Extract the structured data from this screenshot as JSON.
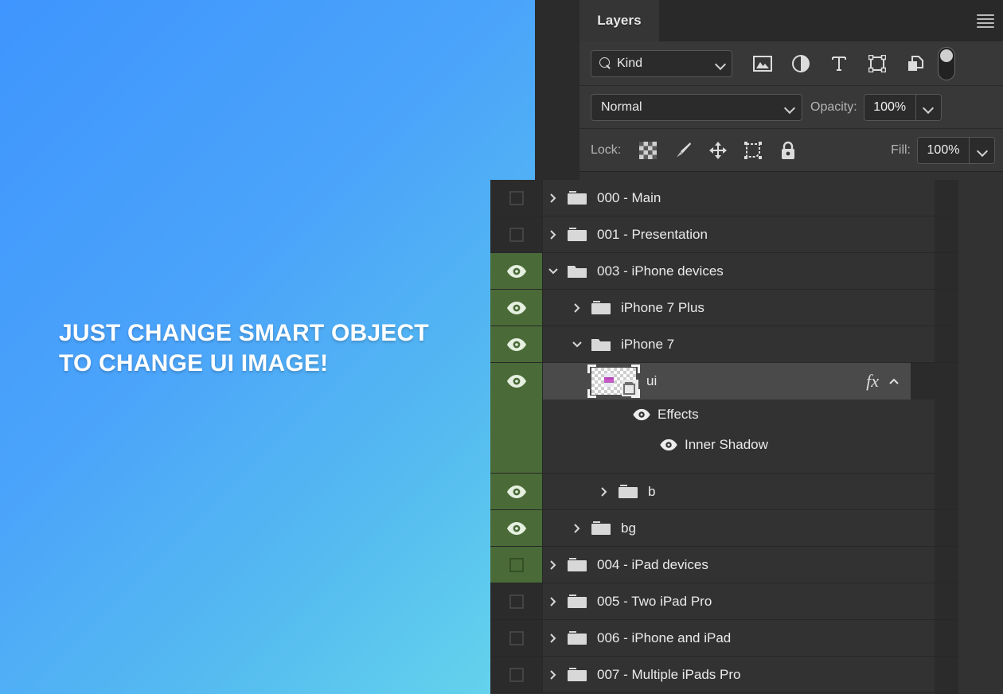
{
  "artwork": {
    "headline_line1": "JUST CHANGE SMART OBJECT",
    "headline_line2": "TO CHANGE UI IMAGE!",
    "gradient_start": "#3f95fd",
    "gradient_end": "#66d6ec"
  },
  "panel": {
    "tab_label": "Layers",
    "menu_icon": "hamburger-menu-icon",
    "filter": {
      "kind_label": "Kind",
      "search_icon": "search-icon",
      "dropdown_icon": "chevron-down-icon",
      "icons": [
        {
          "name": "pixel-layer-filter-icon",
          "title": "Pixels"
        },
        {
          "name": "adjustment-layer-filter-icon",
          "title": "Adjustment"
        },
        {
          "name": "type-layer-filter-icon",
          "title": "Type"
        },
        {
          "name": "shape-layer-filter-icon",
          "title": "Shape"
        },
        {
          "name": "smart-object-filter-icon",
          "title": "Smart Object"
        }
      ],
      "toggle_name": "filter-enable-toggle"
    },
    "blend": {
      "mode": "Normal",
      "opacity_label": "Opacity:",
      "opacity_value": "100%"
    },
    "lock": {
      "label": "Lock:",
      "icons": [
        {
          "name": "lock-transparent-pixels-icon"
        },
        {
          "name": "lock-image-pixels-brush-icon"
        },
        {
          "name": "lock-position-move-icon"
        },
        {
          "name": "lock-artboard-nesting-icon"
        },
        {
          "name": "lock-all-padlock-icon"
        }
      ],
      "fill_label": "Fill:",
      "fill_value": "100%"
    },
    "layers": [
      {
        "name": "000 - Main",
        "visible": false,
        "expanded": false,
        "indent": 1,
        "type": "group",
        "selected": false
      },
      {
        "name": "001 - Presentation",
        "visible": false,
        "expanded": false,
        "indent": 1,
        "type": "group",
        "selected": false
      },
      {
        "name": "003 - iPhone devices",
        "visible": true,
        "expanded": true,
        "indent": 1,
        "type": "group",
        "selected": false
      },
      {
        "name": "iPhone 7 Plus",
        "visible": true,
        "expanded": false,
        "indent": 2,
        "type": "group",
        "selected": false
      },
      {
        "name": "iPhone 7",
        "visible": true,
        "expanded": true,
        "indent": 2,
        "type": "group",
        "selected": false
      },
      {
        "name": "ui",
        "visible": true,
        "expanded": null,
        "indent": 3,
        "type": "smart-object",
        "selected": true,
        "fx": "fx"
      },
      {
        "name": "b",
        "visible": true,
        "expanded": false,
        "indent": 3,
        "type": "group",
        "selected": false
      },
      {
        "name": "bg",
        "visible": true,
        "expanded": false,
        "indent": 2,
        "type": "group",
        "selected": false
      },
      {
        "name": "004 - iPad devices",
        "visible": false,
        "expanded": false,
        "indent": 1,
        "type": "group",
        "selected": false,
        "eye_cell_green": true
      },
      {
        "name": "005 - Two iPad Pro",
        "visible": false,
        "expanded": false,
        "indent": 1,
        "type": "group",
        "selected": false
      },
      {
        "name": "006 - iPhone and iPad",
        "visible": false,
        "expanded": false,
        "indent": 1,
        "type": "group",
        "selected": false
      },
      {
        "name": "007 - Multiple iPads Pro",
        "visible": false,
        "expanded": false,
        "indent": 1,
        "type": "group",
        "selected": false
      }
    ],
    "effects": {
      "group_label": "Effects",
      "items": [
        {
          "label": "Inner Shadow"
        }
      ]
    }
  }
}
